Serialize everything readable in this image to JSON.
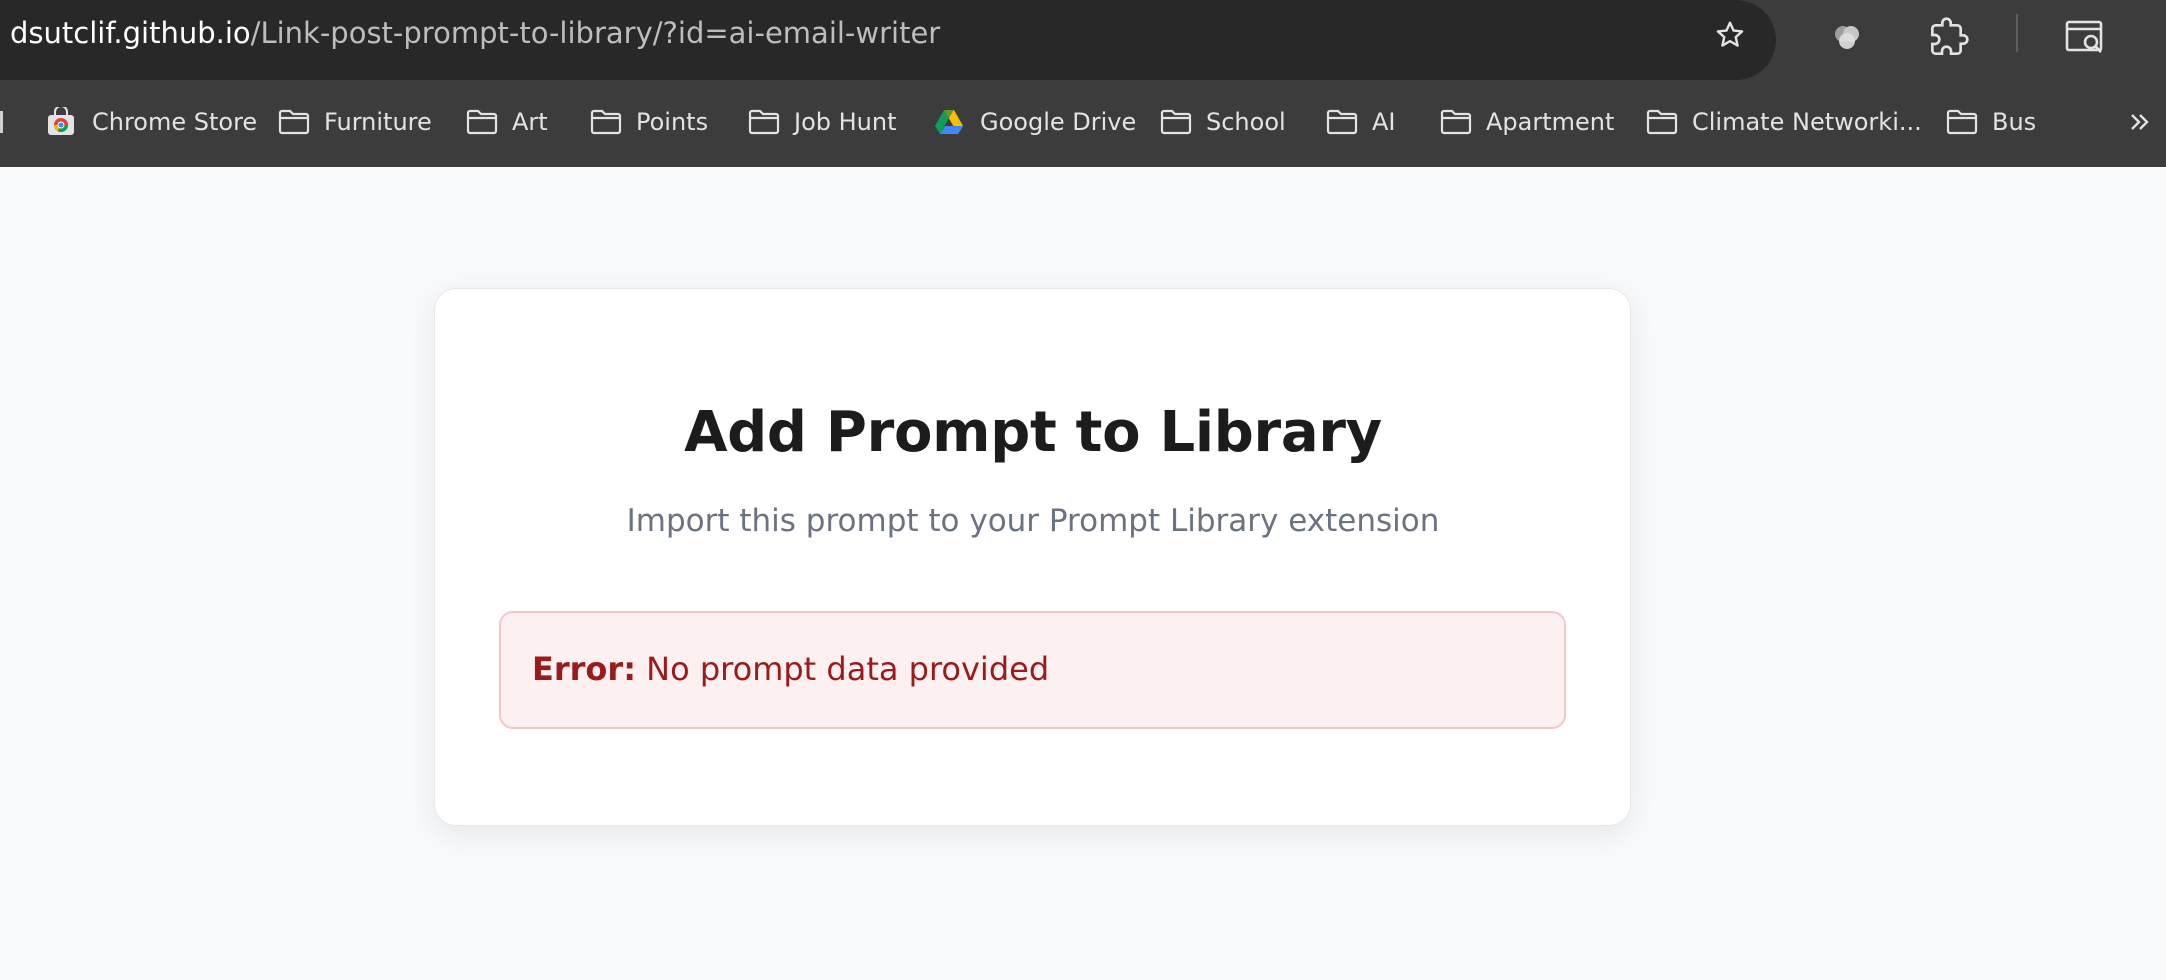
{
  "browser": {
    "url_domain": "dsutclif.github.io",
    "url_path": "/Link-post-prompt-to-library/?id=ai-email-writer",
    "toolbar_icons": [
      "star-icon",
      "profile-icon",
      "extensions-icon",
      "tab-search-icon"
    ],
    "bookmarks": [
      {
        "label": "Chrome Store",
        "icon": "chrome-store-icon"
      },
      {
        "label": "Furniture",
        "icon": "folder-icon"
      },
      {
        "label": "Art",
        "icon": "folder-icon"
      },
      {
        "label": "Points",
        "icon": "folder-icon"
      },
      {
        "label": "Job Hunt",
        "icon": "folder-icon"
      },
      {
        "label": "Google Drive",
        "icon": "google-drive-icon"
      },
      {
        "label": "School",
        "icon": "folder-icon"
      },
      {
        "label": "AI",
        "icon": "folder-icon"
      },
      {
        "label": "Apartment",
        "icon": "folder-icon"
      },
      {
        "label": "Climate Networki...",
        "icon": "folder-icon"
      },
      {
        "label": "Bus",
        "icon": "folder-icon"
      }
    ]
  },
  "page": {
    "title": "Add Prompt to Library",
    "subtitle": "Import this prompt to your Prompt Library extension",
    "error_label": "Error:",
    "error_message": "No prompt data provided"
  }
}
